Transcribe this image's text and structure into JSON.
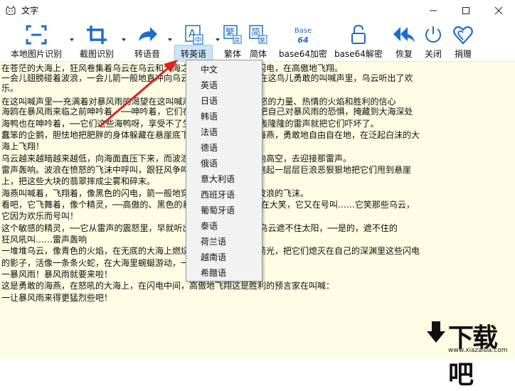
{
  "window": {
    "title": "文字"
  },
  "toolbar": {
    "items": [
      {
        "label": "本地图片识别"
      },
      {
        "label": "截图识别"
      },
      {
        "label": "转语音"
      },
      {
        "label": "转英语"
      },
      {
        "label": "繁体"
      },
      {
        "label": "简体"
      },
      {
        "label": "base64加密"
      },
      {
        "label": "base64解密"
      },
      {
        "label": "恢复"
      },
      {
        "label": "关闭"
      },
      {
        "label": "捐赠"
      }
    ],
    "icon_text": {
      "fanti": "繁",
      "fanti_small": "简",
      "jianti": "简",
      "jianti_small": "繁",
      "base64_top": "Base",
      "base64_bottom": "64",
      "translate_letter": "A",
      "translate_han": "中"
    }
  },
  "content": {
    "lines": [
      "在苍茫的大海上，狂风卷集着乌云在乌云和大海之间，海燕像黑色的闪电，在高傲地飞翔。",
      "一会儿翅膀碰着波浪，一会儿箭一般地直冲向乌云，它叫喊着，──就在这鸟儿勇敢的叫喊声里，乌云听出了欢",
      "乐。",
      "在这叫喊声里──充满着对暴风雨的渴望在这叫喊声里，乌云听出了愤怒的力量、热情的火焰和胜利的信心",
      "海鸥在暴风雨来临之前呻吟着，──呻吟着，它们在大海上面飞窜，想把自己对暴风雨的恐惧，掩藏到大海深处",
      "海鸭也在呻吟着，──它们这些海鸭呀，享受不了生活的战斗的欢乐：轰隆隆的雷声就把它们吓坏了。",
      "蠢笨的企鹅，胆怯地把肥胖的身体躲藏在悬崖底下……只有那高傲的海燕，勇敢地自由自在地，在泛起白沫的大",
      "海上飞翔！",
      "乌云越来越暗越来越低，向海面直压下来，而波浪一边歌唱，一边冲向高空，去迎接那雷声。",
      "雷声轰响。波浪在愤怒的飞沫中呼叫，跟狂风争鸣。看吧，狂风紧紧抱起一层层巨浪恶狠狠地把它们甩到悬崖",
      "上，把这些大块的翡翠摔成尘雾和碎末。",
      "海燕叫喊着，飞翔着，像黑色的闪电，箭一般地穿过乌云，翅膀掠起波浪的飞沫。",
      "看吧，它飞舞着，像个精灵，──高傲的、黑色的暴风雨的精灵，──它在大笑，它又在号叫……它笑那些乌云，",
      "它因为欢乐而号叫！",
      "这个敏感的精灵，──它从雷声的震怒里，早就听出了困乏，它深信，乌云遮不住太阳，──是的，遮不住的",
      "狂风吼叫……雷声轰响",
      "一堆堆乌云，像青色的火焰，在无底的大海上燃烧。大海抓住闪电的箭光，把它们熄灭在自己的深渊里这些闪电",
      "的影子，活像一条条火蛇，在大海里蜿蜒游动，一晃就消失了。",
      "一暴风雨！暴风雨就要来啦！",
      "这是勇敢的海燕，在怒吼的大海上，在闪电中间，高傲地飞翔这是胜利的预言家在叫喊：",
      "一让暴风雨来得更猛烈些吧！"
    ]
  },
  "menu": {
    "items": [
      "中文",
      "英语",
      "日语",
      "韩语",
      "法语",
      "德语",
      "俄语",
      "意大利语",
      "西班牙语",
      "葡萄牙语",
      "泰语",
      "荷兰语",
      "越南语",
      "希腊语"
    ]
  },
  "watermark": {
    "text": "下载吧",
    "url": "www.xiazaiba.com"
  },
  "colors": {
    "accent": "#1e6ec8",
    "content_bg": "#fdfde3",
    "arrow": "#e02020",
    "menu_bg": "#f2f2f2",
    "selected_tool": "#cce4f7"
  }
}
